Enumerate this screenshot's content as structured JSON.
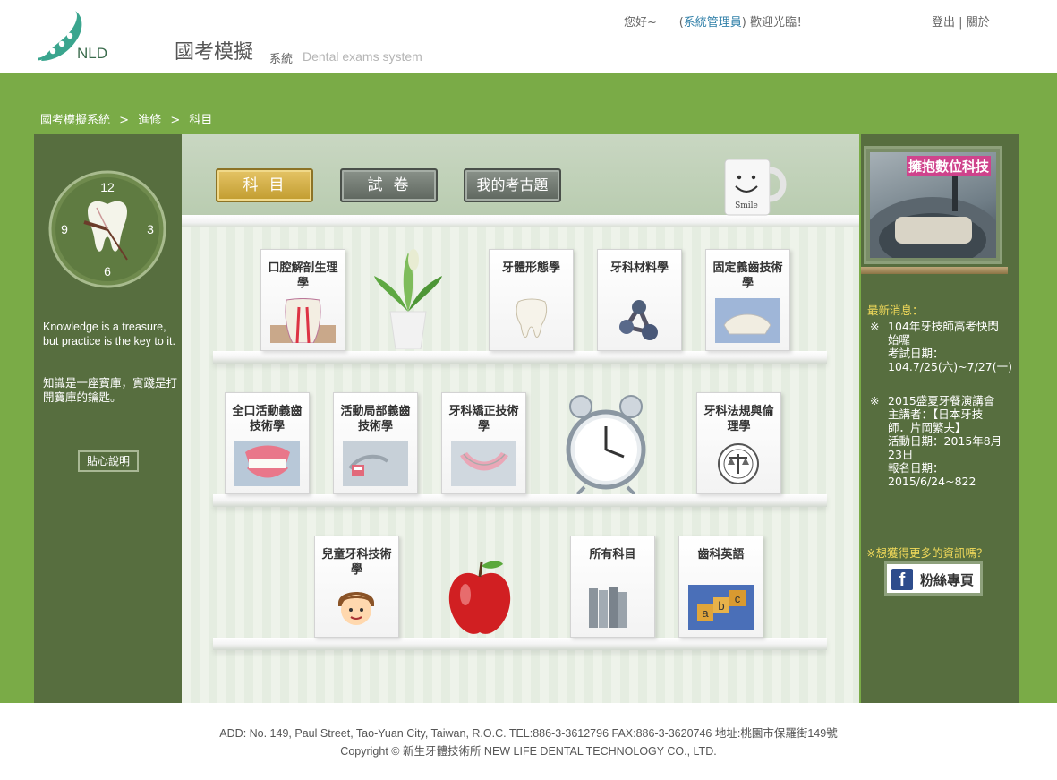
{
  "header": {
    "logo_text": "NLD",
    "title": "國考模擬",
    "subtitle_zh": "系統",
    "subtitle_en": "Dental exams system",
    "greeting": "您好~",
    "admin_prefix": "(",
    "admin_name": "系統管理員",
    "admin_suffix": ") 歡迎光臨！",
    "logout": "登出",
    "separator": "|",
    "close": "關於"
  },
  "breadcrumb": [
    "國考模擬系統",
    ">",
    "進修",
    ">",
    "科目"
  ],
  "left": {
    "clock_numbers": [
      "12",
      "3",
      "6",
      "9"
    ],
    "quote_en": "Knowledge is a treasure, but practice is the key to it.",
    "quote_zh": "知識是一座寶庫，實踐是打開寶庫的鑰匙。",
    "help_button": "貼心說明"
  },
  "tabs": [
    {
      "label": "科目",
      "active": true
    },
    {
      "label": "試卷",
      "active": false
    },
    {
      "label": "我的考古題",
      "active": false
    }
  ],
  "mug_text": "Smile",
  "subjects": [
    {
      "label": "口腔解剖生理學",
      "icon": "tooth-anatomy-icon"
    },
    {
      "label": "牙體形態學",
      "icon": "tooth-icon"
    },
    {
      "label": "牙科材料學",
      "icon": "molecule-icon"
    },
    {
      "label": "固定義齒技術學",
      "icon": "bridge-icon"
    },
    {
      "label": "全口活動義齒技術學",
      "icon": "denture-icon"
    },
    {
      "label": "活動局部義齒技術學",
      "icon": "partial-denture-icon"
    },
    {
      "label": "牙科矯正技術學",
      "icon": "orthodontic-icon"
    },
    {
      "label": "牙科法規與倫理學",
      "icon": "law-seal-icon"
    },
    {
      "label": "兒童牙科技術學",
      "icon": "child-icon"
    },
    {
      "label": "所有科目",
      "icon": "books-icon"
    },
    {
      "label": "齒科英語",
      "icon": "abc-blocks-icon"
    }
  ],
  "right": {
    "banner_title": "擁抱數位科技",
    "news_title": "最新消息：",
    "news": [
      {
        "mark": "※",
        "text": "104年牙技師高考快閃始囉",
        "detail1": "考試日期：",
        "detail2": "104.7/25(六)~7/27(一)"
      },
      {
        "mark": "※",
        "text": "2015盛夏牙餐演講會",
        "detail1": "主講者：【日本牙技師．片岡繁夫】",
        "detail2": "活動日期：2015年8月23日",
        "detail3": "報名日期：2015/6/24~822"
      }
    ],
    "more_info": "※想獲得更多的資訊嗎？",
    "fb_label": "粉絲專頁"
  },
  "footer": {
    "address": "ADD: No. 149, Paul Street, Tao-Yuan City, Taiwan, R.O.C. TEL:886-3-3612796 FAX:886-3-3620746 地址:桃園市保羅街149號",
    "copyright": "Copyright © 新生牙體技術所 NEW LIFE DENTAL TECHNOLOGY CO., LTD."
  },
  "colors": {
    "band": "#7aab47",
    "panel": "#576e3f",
    "active_tab": "#c19c2f",
    "news_title": "#f2da5a"
  }
}
